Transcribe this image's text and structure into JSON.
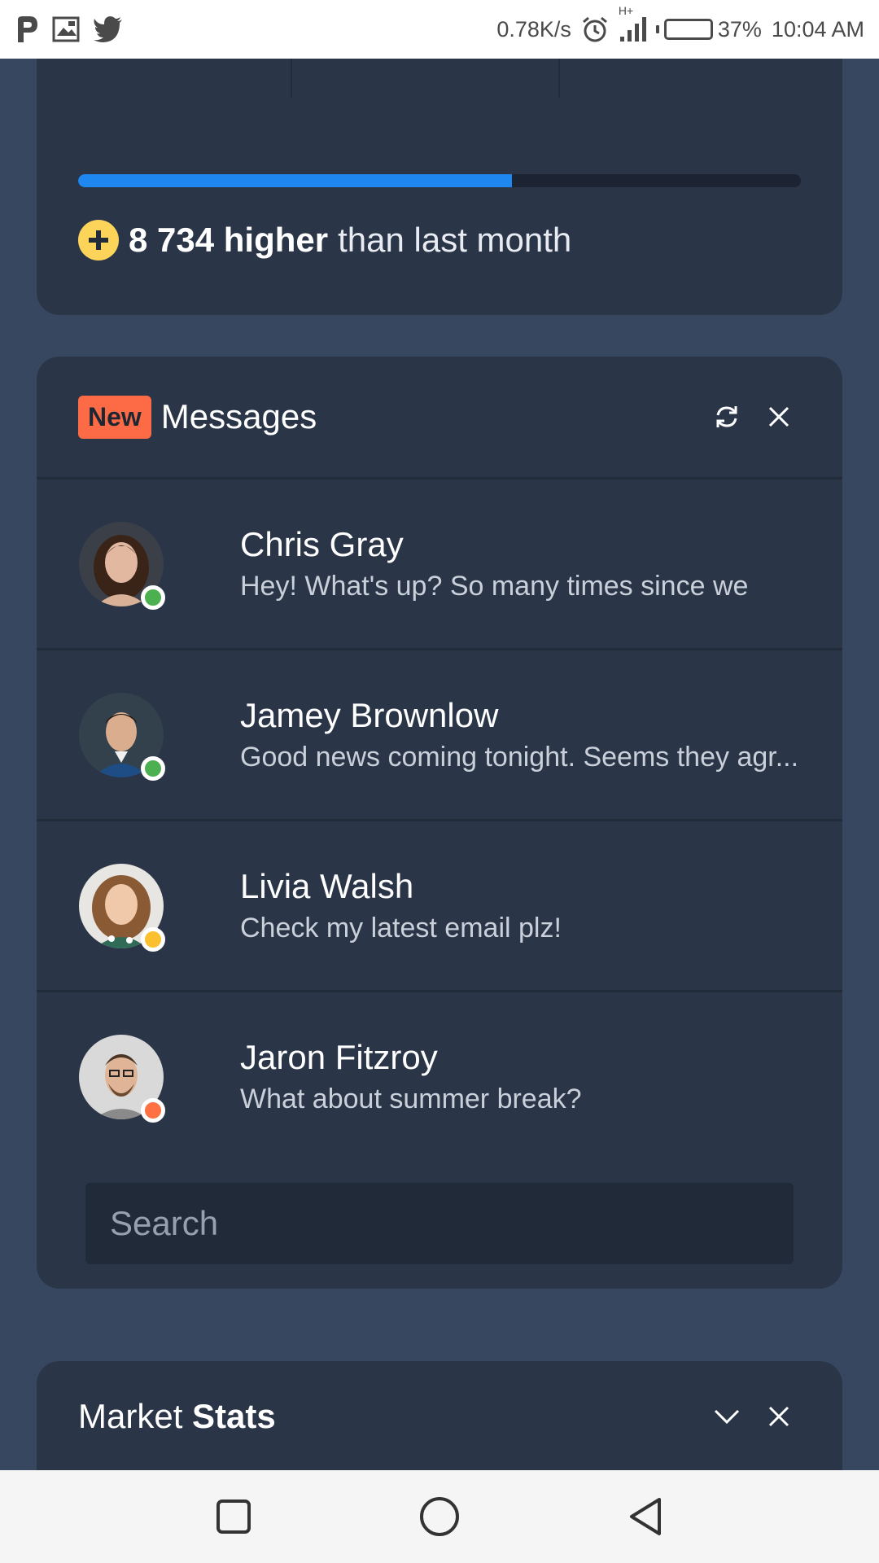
{
  "status_bar": {
    "network_speed": "0.78K/s",
    "signal_type": "H+",
    "battery_percent_text": "37%",
    "battery_level": 0.37,
    "time": "10:04 AM",
    "left_icons": [
      "pinterest-icon",
      "image-icon",
      "twitter-icon"
    ]
  },
  "summary_card": {
    "progress_fraction": 0.6,
    "trend_value": "8 734 higher",
    "trend_rest": "than last month",
    "accent_color": "#1e88f0"
  },
  "messages_card": {
    "badge": "New",
    "title": "Messages",
    "actions": [
      "refresh-icon",
      "close-icon"
    ],
    "items": [
      {
        "name": "Chris Gray",
        "preview": "Hey! What's up? So many times since we",
        "status": "online",
        "status_color": "#4caf50"
      },
      {
        "name": "Jamey Brownlow",
        "preview": "Good news coming tonight. Seems they agr...",
        "status": "online",
        "status_color": "#4caf50"
      },
      {
        "name": "Livia Walsh",
        "preview": "Check my latest email plz!",
        "status": "away",
        "status_color": "#fbc02d"
      },
      {
        "name": "Jaron Fitzroy",
        "preview": "What about summer break?",
        "status": "busy",
        "status_color": "#ff7043"
      }
    ],
    "search": {
      "placeholder": "Search",
      "value": ""
    }
  },
  "market_card": {
    "title_regular": "Market",
    "title_bold": "Stats",
    "actions": [
      "chevron-down-icon",
      "close-icon"
    ]
  },
  "nav_bar": {
    "buttons": [
      "recent-apps-icon",
      "home-icon",
      "back-icon"
    ]
  }
}
